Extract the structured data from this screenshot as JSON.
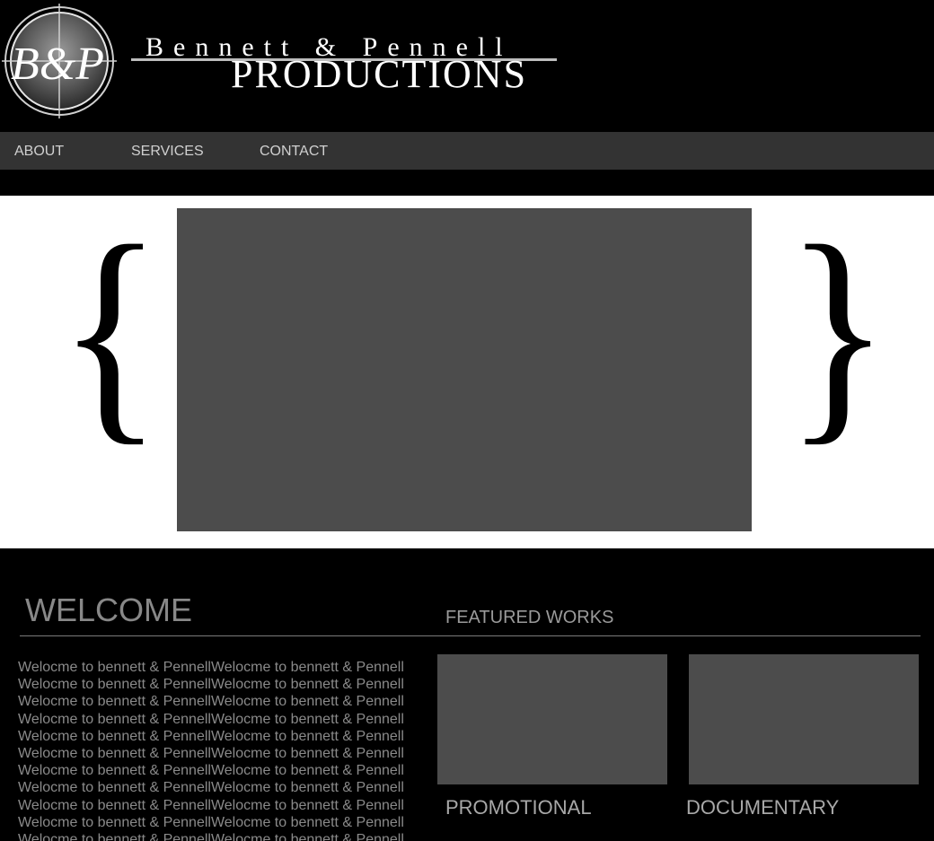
{
  "header": {
    "logo_monogram": "B&P",
    "brand_line1": "Bennett & Pennell",
    "brand_line2": "PRODUCTIONS"
  },
  "nav": {
    "items": [
      {
        "label": "ABOUT"
      },
      {
        "label": "SERVICES"
      },
      {
        "label": "CONTACT"
      }
    ]
  },
  "hero": {
    "brace_left": "{",
    "brace_right": "}"
  },
  "welcome": {
    "title": "WELCOME",
    "body": "Welocme to bennett & PennellWelocme to bennett & PennellWelocme to bennett & PennellWelocme to bennett & PennellWelocme to bennett & PennellWelocme to bennett & PennellWelocme to bennett & PennellWelocme to bennett & PennellWelocme to bennett & PennellWelocme to bennett & PennellWelocme to bennett & PennellWelocme to bennett & PennellWelocme to bennett & PennellWelocme to bennett & PennellWelocme to bennett & PennellWelocme to bennett & PennellWelocme to bennett & PennellWelocme to bennett & PennellWelocme to bennett & PennellWelocme to bennett & PennellWelocme to bennett & PennellWelocme to bennett & Pennell"
  },
  "featured": {
    "title": "FEATURED WORKS",
    "works": [
      {
        "label": "PROMOTIONAL"
      },
      {
        "label": "DOCUMENTARY"
      }
    ]
  },
  "colors": {
    "background": "#000000",
    "nav_bar": "#333333",
    "media_placeholder": "#4c4c4c",
    "hero_background": "#ffffff"
  }
}
